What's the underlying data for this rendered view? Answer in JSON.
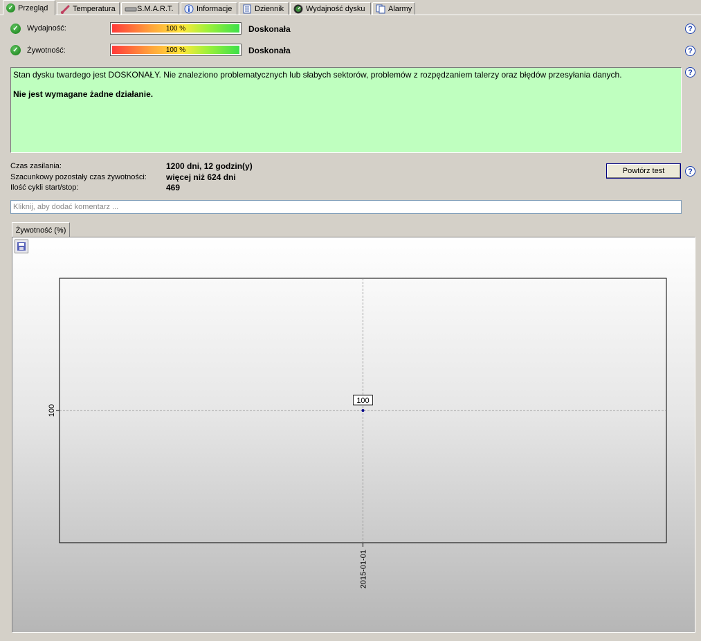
{
  "tabs": [
    {
      "label": "Przegląd",
      "icon": "check-icon",
      "active": true
    },
    {
      "label": "Temperatura",
      "icon": "thermometer-icon",
      "active": false
    },
    {
      "label": "S.M.A.R.T.",
      "icon": "disk-drive-icon",
      "active": false
    },
    {
      "label": "Informacje",
      "icon": "info-icon",
      "active": false
    },
    {
      "label": "Dziennik",
      "icon": "document-icon",
      "active": false
    },
    {
      "label": "Wydajność dysku",
      "icon": "speedometer-icon",
      "active": false
    },
    {
      "label": "Alarmy",
      "icon": "copy-icon",
      "active": false
    }
  ],
  "status": {
    "performance": {
      "label": "Wydajność:",
      "value_text": "100 %",
      "percent": 100,
      "rating": "Doskonała"
    },
    "health": {
      "label": "Żywotność:",
      "value_text": "100 %",
      "percent": 100,
      "rating": "Doskonała"
    }
  },
  "message": {
    "text": "Stan dysku twardego jest DOSKONAŁY. Nie znaleziono problematycznych lub słabych sektorów, problemów z rozpędzaniem talerzy oraz błędów przesyłania danych.",
    "action": "Nie jest wymagane żadne działanie."
  },
  "stats": {
    "power_on_label": "Czas zasilania:",
    "power_on_value": "1200 dni, 12 godzin(y)",
    "remaining_label": "Szacunkowy pozostały czas żywotności:",
    "remaining_value": "więcej niż 624 dni",
    "cycles_label": "Ilość cykli start/stop:",
    "cycles_value": "469"
  },
  "retest_button": "Powtórz test",
  "comment_placeholder": "Kliknij, aby dodać komentarz ...",
  "chart_tab": "Żywotność (%)",
  "chart_data": {
    "type": "line",
    "title": "",
    "xlabel": "",
    "ylabel": "",
    "x": [
      "2015-01-01"
    ],
    "series": [
      {
        "values": [
          100
        ]
      }
    ],
    "point_labels": [
      "100"
    ],
    "x_ticks": [
      "2015-01-01"
    ],
    "y_ticks": [
      "100"
    ],
    "grid": true,
    "colors": {
      "point": "#00008b",
      "grid": "#8a8a8a"
    }
  },
  "colors": {
    "ok_green_bg": "#bfffbf",
    "accent": "#1a3fb0"
  }
}
